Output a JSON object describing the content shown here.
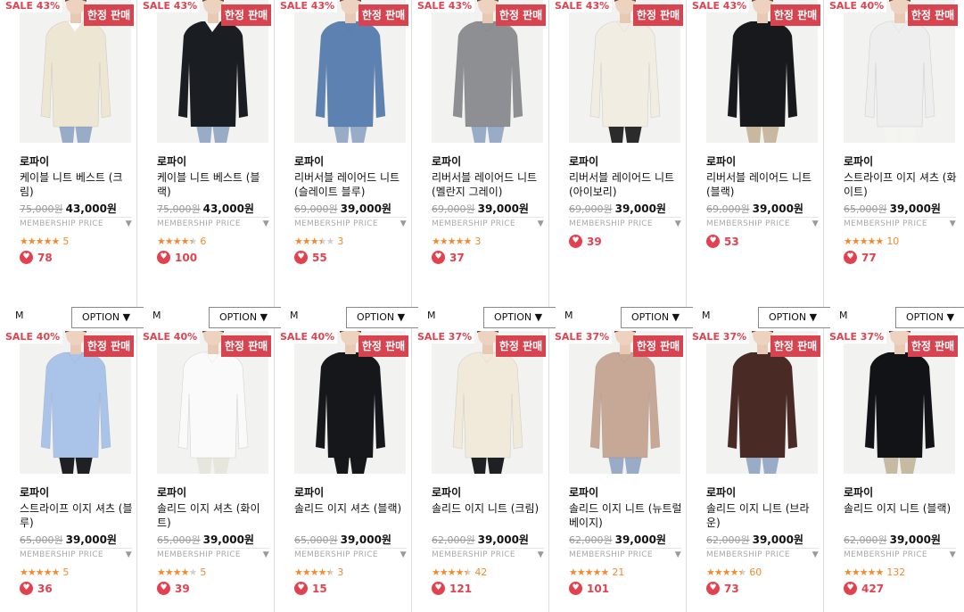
{
  "colors": {
    "accent": "#e2424f",
    "badge_bg": "#d7434f",
    "star": "#f08a2c",
    "muted": "#9a9a9a",
    "divider": "#dcdcdc"
  },
  "icons": {
    "heart": "heart-icon",
    "star": "star-icon",
    "caret": "caret-down-icon"
  },
  "common": {
    "membership_label": "MEMBERSHIP PRICE",
    "option_label": "OPTION ▼",
    "size_label": "M",
    "caret": "▼"
  },
  "rows": [
    {
      "products": [
        {
          "sale": "SALE 43%",
          "badge": "한정 판매",
          "brand": "로파이",
          "name": "케이블 니트 베스트 (크림)",
          "original_price": "75,000원",
          "sale_price": "43,000원",
          "rating_stars": 5,
          "stars": "★★★★★",
          "review_count": "5",
          "likes": "78",
          "garment": "#ece6d2",
          "garment2": "#ffffff",
          "pants": "#98acc8"
        },
        {
          "sale": "SALE 43%",
          "badge": "한정 판매",
          "brand": "로파이",
          "name": "케이블 니트 베스트 (블랙)",
          "original_price": "75,000원",
          "sale_price": "43,000원",
          "rating_stars": 4.5,
          "stars": "★★★★★",
          "review_count": "6",
          "likes": "100",
          "garment": "#1a1d22",
          "garment2": "#ffffff",
          "pants": "#98acc8"
        },
        {
          "sale": "SALE 43%",
          "badge": "한정 판매",
          "brand": "로파이",
          "name": "리버서블 레이어드 니트 (슬레이트 블루)",
          "original_price": "69,000원",
          "sale_price": "39,000원",
          "rating_stars": 3.5,
          "stars": "★★★★★",
          "review_count": "3",
          "likes": "55",
          "garment": "#5d82b2",
          "garment2": "#5d82b2",
          "pants": "#98acc8"
        },
        {
          "sale": "SALE 43%",
          "badge": "한정 판매",
          "brand": "로파이",
          "name": "리버서블 레이어드 니트 (멜란지 그레이)",
          "original_price": "69,000원",
          "sale_price": "39,000원",
          "rating_stars": 5,
          "stars": "★★★★★",
          "review_count": "3",
          "likes": "37",
          "garment": "#8d8f93",
          "garment2": "#8d8f93",
          "pants": "#98acc8"
        },
        {
          "sale": "SALE 43%",
          "badge": "한정 판매",
          "brand": "로파이",
          "name": "리버서블 레이어드 니트 (아이보리)",
          "original_price": "69,000원",
          "sale_price": "39,000원",
          "rating_stars": 0,
          "stars": "",
          "review_count": "",
          "likes": "39",
          "garment": "#f1ede3",
          "garment2": "#f1ede3",
          "pants": "#2b2b2b"
        },
        {
          "sale": "SALE 43%",
          "badge": "한정 판매",
          "brand": "로파이",
          "name": "리버서블 레이어드 니트 (블랙)",
          "original_price": "69,000원",
          "sale_price": "39,000원",
          "rating_stars": 0,
          "stars": "",
          "review_count": "",
          "likes": "53",
          "garment": "#17191d",
          "garment2": "#17191d",
          "pants": "#c8b8a0"
        },
        {
          "sale": "SALE 40%",
          "badge": "한정 판매",
          "brand": "로파이",
          "name": "스트라이프 이지 셔츠 (화이트)",
          "original_price": "65,000원",
          "sale_price": "39,000원",
          "rating_stars": 5,
          "stars": "★★★★★",
          "review_count": "10",
          "likes": "77",
          "garment": "#eeeeee",
          "garment2": "#eeeeee",
          "pants": "#f4f4f0"
        }
      ]
    },
    {
      "products": [
        {
          "sale": "SALE 40%",
          "badge": "한정 판매",
          "brand": "로파이",
          "name": "스트라이프 이지 셔츠 (블루)",
          "original_price": "65,000원",
          "sale_price": "39,000원",
          "rating_stars": 5,
          "stars": "★★★★★",
          "review_count": "5",
          "likes": "36",
          "garment": "#a9c4e8",
          "garment2": "#a9c4e8",
          "pants": "#1e2024"
        },
        {
          "sale": "SALE 40%",
          "badge": "한정 판매",
          "brand": "로파이",
          "name": "솔리드 이지 셔츠 (화이트)",
          "original_price": "65,000원",
          "sale_price": "39,000원",
          "rating_stars": 4,
          "stars": "★★★★★",
          "review_count": "5",
          "likes": "39",
          "garment": "#fafafa",
          "garment2": "#fafafa",
          "pants": "#e6e6dd"
        },
        {
          "sale": "SALE 40%",
          "badge": "한정 판매",
          "brand": "로파이",
          "name": "솔리드 이지 셔츠 (블랙)",
          "original_price": "65,000원",
          "sale_price": "39,000원",
          "rating_stars": 4.5,
          "stars": "★★★★★",
          "review_count": "3",
          "likes": "15",
          "garment": "#15171a",
          "garment2": "#15171a",
          "pants": "#15171a"
        },
        {
          "sale": "SALE 37%",
          "badge": "한정 판매",
          "brand": "로파이",
          "name": "솔리드 이지 니트 (크림)",
          "original_price": "62,000원",
          "sale_price": "39,000원",
          "rating_stars": 4.5,
          "stars": "★★★★★",
          "review_count": "42",
          "likes": "121",
          "garment": "#f1eadb",
          "garment2": "#f1eadb",
          "pants": "#1e2024"
        },
        {
          "sale": "SALE 37%",
          "badge": "한정 판매",
          "brand": "로파이",
          "name": "솔리드 이지 니트 (뉴트럴 베이지)",
          "original_price": "62,000원",
          "sale_price": "39,000원",
          "rating_stars": 5,
          "stars": "★★★★★",
          "review_count": "21",
          "likes": "101",
          "garment": "#c7a796",
          "garment2": "#c7a796",
          "pants": "#98acc8"
        },
        {
          "sale": "SALE 37%",
          "badge": "한정 판매",
          "brand": "로파이",
          "name": "솔리드 이지 니트 (브라운)",
          "original_price": "62,000원",
          "sale_price": "39,000원",
          "rating_stars": 4.5,
          "stars": "★★★★★",
          "review_count": "60",
          "likes": "73",
          "garment": "#4a2a24",
          "garment2": "#4a2a24",
          "pants": "#98acc8"
        },
        {
          "sale": "SALE 37%",
          "badge": "한정 판매",
          "brand": "로파이",
          "name": "솔리드 이지 니트 (블랙)",
          "original_price": "62,000원",
          "sale_price": "39,000원",
          "rating_stars": 5,
          "stars": "★★★★★",
          "review_count": "132",
          "likes": "427",
          "garment": "#121316",
          "garment2": "#121316",
          "pants": "#c6bba2"
        }
      ]
    }
  ]
}
